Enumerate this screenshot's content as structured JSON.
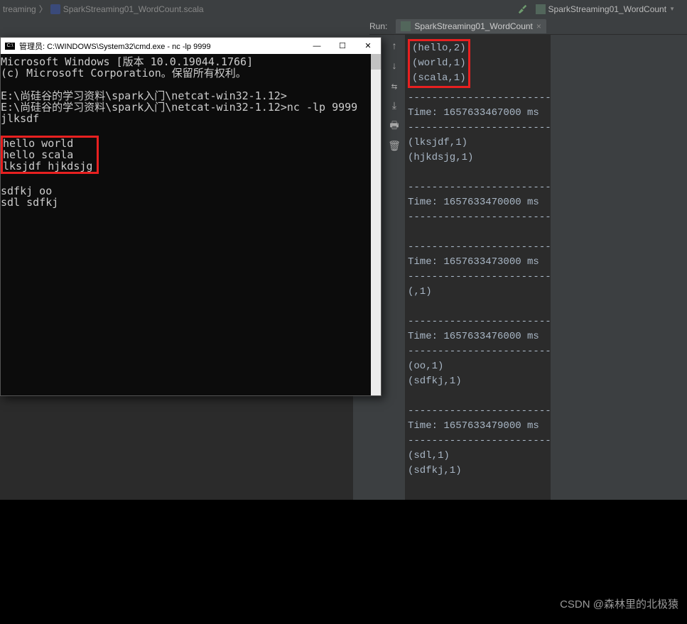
{
  "breadcrumb": {
    "parent": "treaming",
    "sep": "〉",
    "filename": "SparkStreaming01_WordCount.scala"
  },
  "run_config": {
    "name": "SparkStreaming01_WordCount"
  },
  "run_panel": {
    "label": "Run:",
    "tab_name": "SparkStreaming01_WordCount",
    "close": "×"
  },
  "console_output": {
    "highlight": "(hello,2)\n(world,1)\n(scala,1)",
    "rest": "\n-------------------------\nTime: 1657633467000 ms\n-------------------------\n(lksjdf,1)\n(hjkdsjg,1)\n\n-------------------------\nTime: 1657633470000 ms\n-------------------------\n\n-------------------------\nTime: 1657633473000 ms\n-------------------------\n(,1)\n\n-------------------------\nTime: 1657633476000 ms\n-------------------------\n(oo,1)\n(sdfkj,1)\n\n-------------------------\nTime: 1657633479000 ms\n-------------------------\n(sdl,1)\n(sdfkj,1)"
  },
  "cmd": {
    "title": "管理员: C:\\WINDOWS\\System32\\cmd.exe - nc  -lp 9999",
    "min": "—",
    "max": "☐",
    "close": "✕",
    "line1": "Microsoft Windows [版本 10.0.19044.1766]",
    "line2": "(c) Microsoft Corporation。保留所有权利。",
    "line3": "E:\\尚硅谷的学习资料\\spark入门\\netcat-win32-1.12>",
    "line4": "E:\\尚硅谷的学习资料\\spark入门\\netcat-win32-1.12>nc -lp 9999",
    "line5": "jlksdf",
    "highlight": "hello world\nhello scala\nlksjdf hjkdsjg",
    "line6": "sdfkj oo",
    "line7": "sdl sdfkj"
  },
  "watermark": "CSDN @森林里的北极猿",
  "icons": {
    "cmd": "C:\\"
  }
}
